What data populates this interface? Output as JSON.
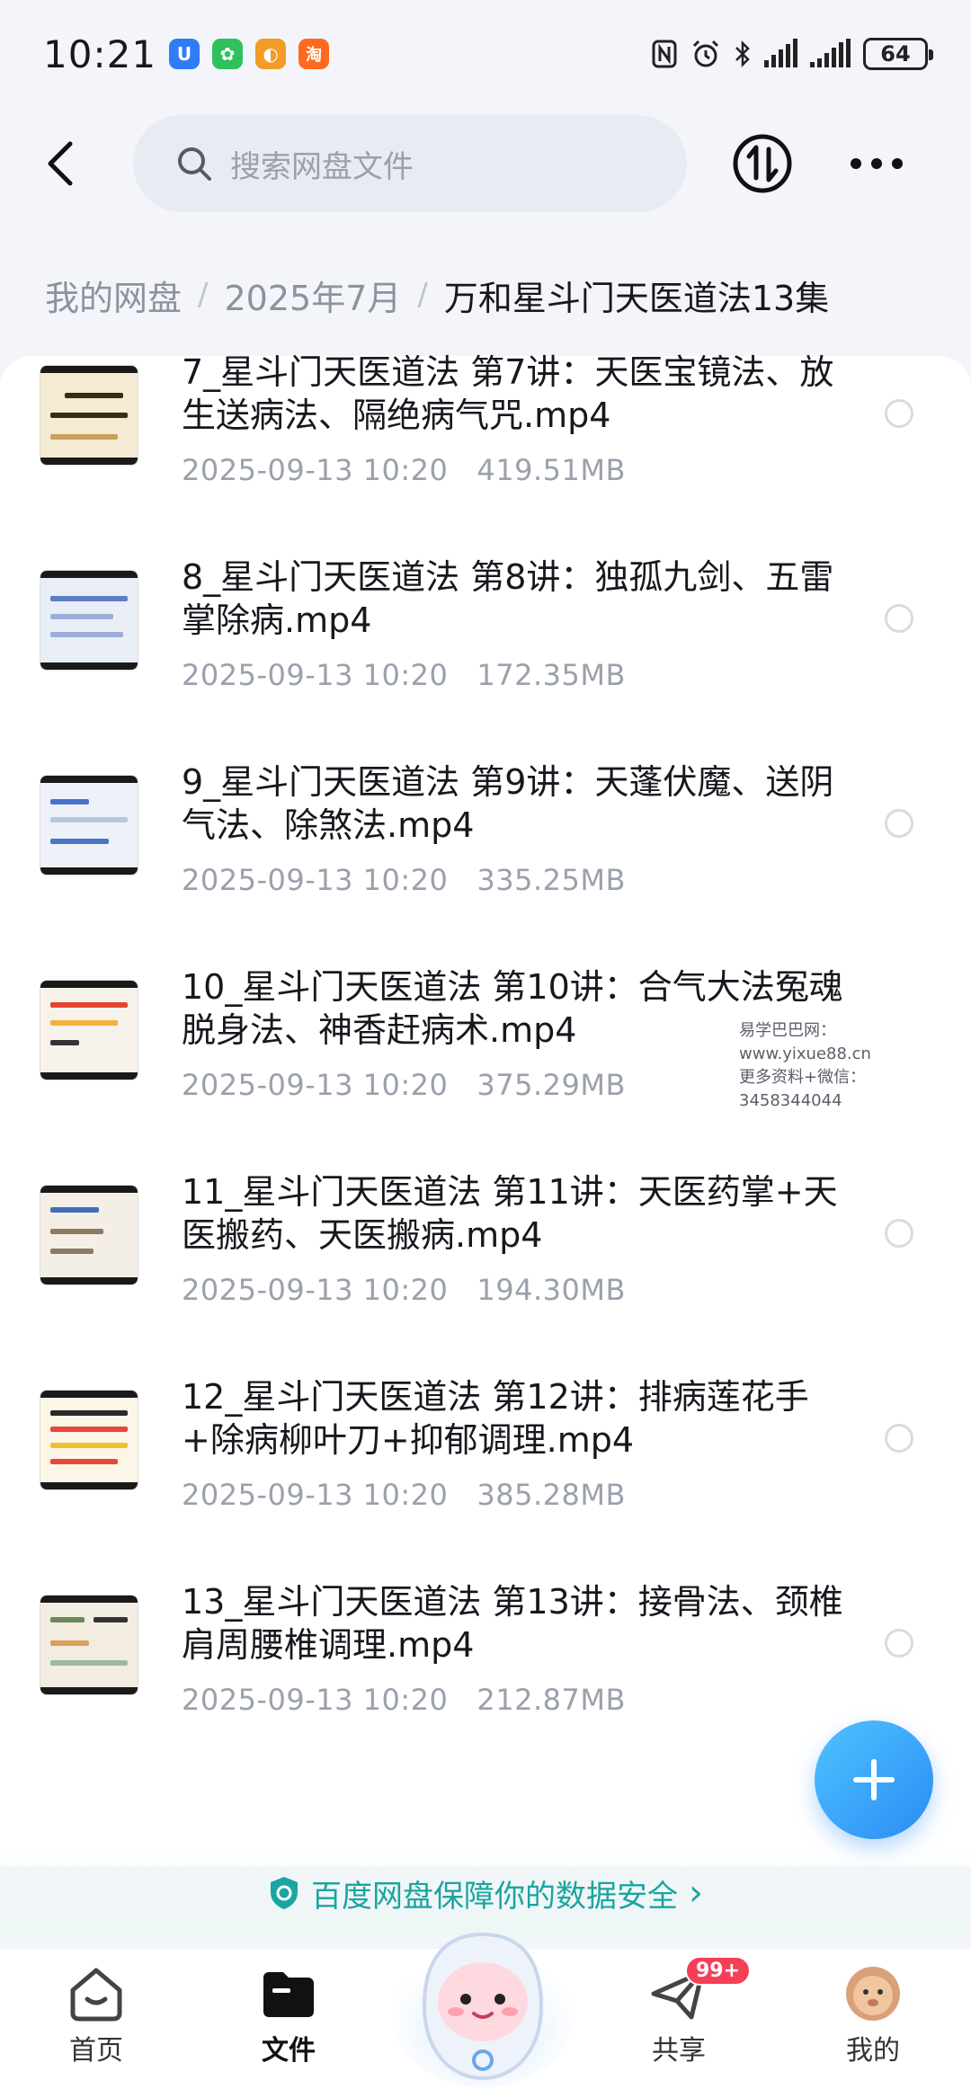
{
  "status_bar": {
    "time": "10:21",
    "app_badges": [
      "U",
      "✿",
      "◐",
      "淘"
    ],
    "battery": "64"
  },
  "search": {
    "placeholder": "搜索网盘文件"
  },
  "breadcrumb": {
    "root": "我的网盘",
    "folder": "2025年7月",
    "current": "万和星斗门天医道法13集"
  },
  "files": [
    {
      "name": "7_星斗门天医道法 第7讲：天医宝镜法、放生送病法、隔绝病气咒.mp4",
      "date": "2025-09-13  10:20",
      "size": "419.51MB"
    },
    {
      "name": "8_星斗门天医道法 第8讲：独孤九剑、五雷掌除病.mp4",
      "date": "2025-09-13  10:20",
      "size": "172.35MB"
    },
    {
      "name": "9_星斗门天医道法 第9讲：天蓬伏魔、送阴气法、除煞法.mp4",
      "date": "2025-09-13  10:20",
      "size": "335.25MB"
    },
    {
      "name": "10_星斗门天医道法 第10讲：合气大法冤魂脱身法、神香赶病术.mp4",
      "date": "2025-09-13  10:20",
      "size": "375.29MB"
    },
    {
      "name": "11_星斗门天医道法 第11讲：天医药掌+天医搬药、天医搬病.mp4",
      "date": "2025-09-13  10:20",
      "size": "194.30MB"
    },
    {
      "name": "12_星斗门天医道法 第12讲：排病莲花手+除病柳叶刀+抑郁调理.mp4",
      "date": "2025-09-13  10:20",
      "size": "385.28MB"
    },
    {
      "name": "13_星斗门天医道法 第13讲：接骨法、颈椎肩周腰椎调理.mp4",
      "date": "2025-09-13  10:20",
      "size": "212.87MB"
    }
  ],
  "watermark": {
    "line1": "易学巴巴网：www.yixue88.cn",
    "line2": "更多资料+微信：3458344044"
  },
  "security_banner": {
    "text": "百度网盘保障你的数据安全",
    "arrow": "›"
  },
  "bottom_nav": {
    "home": "首页",
    "files": "文件",
    "share": "共享",
    "share_badge": "99+",
    "mine": "我的"
  },
  "colors": {
    "accent": "#2a8cf5",
    "security": "#1aa5a0",
    "badge": "#f53f56"
  }
}
